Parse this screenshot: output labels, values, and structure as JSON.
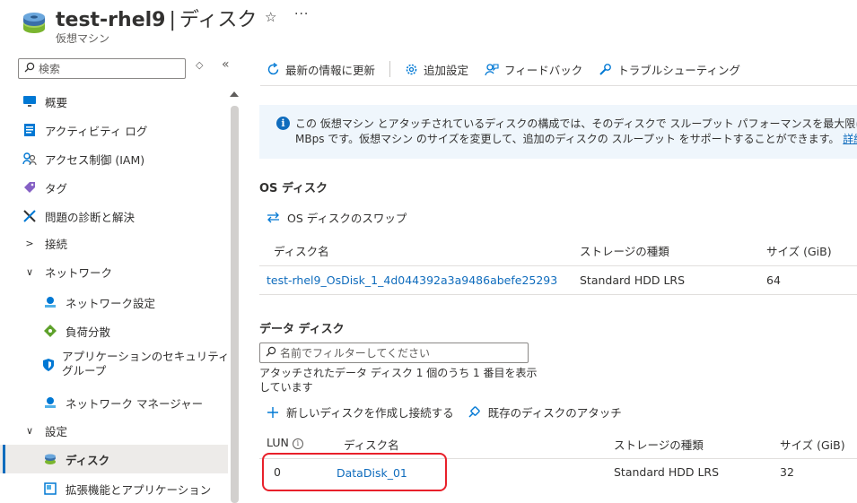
{
  "header": {
    "resource_name": "test-rhel9",
    "separator": "|",
    "page_name": "ディスク",
    "subtitle": "仮想マシン",
    "favorite_icon": "star-icon",
    "more_icon": "more-icon"
  },
  "sidebar": {
    "search_placeholder": "検索",
    "items": [
      {
        "label": "概要",
        "icon": "monitor-icon"
      },
      {
        "label": "アクティビティ ログ",
        "icon": "activity-log-icon"
      },
      {
        "label": "アクセス制御 (IAM)",
        "icon": "people-icon"
      },
      {
        "label": "タグ",
        "icon": "tag-icon"
      },
      {
        "label": "問題の診断と解決",
        "icon": "wrench-icon"
      },
      {
        "label": "接続",
        "icon": "chevron-right-icon"
      },
      {
        "label": "ネットワーク",
        "icon": "chevron-down-icon"
      },
      {
        "label": "ネットワーク設定",
        "icon": "network-settings-icon"
      },
      {
        "label": "負荷分散",
        "icon": "load-balancer-icon"
      },
      {
        "label": "アプリケーションのセキュリティ",
        "label2": "グループ",
        "icon": "shield-icon"
      },
      {
        "label": "ネットワーク マネージャー",
        "icon": "network-manager-icon"
      },
      {
        "label": "設定",
        "icon": "chevron-down-icon"
      },
      {
        "label": "ディスク",
        "icon": "disk-icon"
      },
      {
        "label": "拡張機能とアプリケーション",
        "icon": "extension-icon"
      }
    ]
  },
  "toolbar": {
    "refresh": "最新の情報に更新",
    "settings": "追加設定",
    "feedback": "フィードバック",
    "troubleshoot": "トラブルシューティング"
  },
  "info": {
    "line1": "この 仮想マシン とアタッチされているディスクの構成では、そのディスクで スループット パフォーマンスを最大限に利用できない可能性があり",
    "line2": "MBps です。仮想マシン のサイズを変更して、追加のディスクの スループット をサポートすることができます。",
    "link": "詳細情報"
  },
  "os_disk": {
    "title": "OS ディスク",
    "swap": "OS ディスクのスワップ",
    "columns": [
      "ディスク名",
      "ストレージの種類",
      "サイズ (GiB)"
    ],
    "row": {
      "name": "test-rhel9_OsDisk_1_4d044392a3a9486abefe25293",
      "storage": "Standard HDD LRS",
      "size": "64"
    }
  },
  "data_disks": {
    "title": "データ ディスク",
    "filter_placeholder": "名前でフィルターしてください",
    "showing": "アタッチされたデータ ディスク 1 個のうち 1 番目を表示しています",
    "create_attach": "新しいディスクを作成し接続する",
    "attach_existing": "既存のディスクのアタッチ",
    "columns": [
      "LUN",
      "ディスク名",
      "ストレージの種類",
      "サイズ (GiB)"
    ],
    "rows": [
      {
        "lun": "0",
        "name": "DataDisk_01",
        "storage": "Standard HDD LRS",
        "size": "32"
      }
    ]
  },
  "colors": {
    "accent": "#0f6cbd",
    "highlight": "#e8202a",
    "info_bg": "#eff6fc"
  }
}
